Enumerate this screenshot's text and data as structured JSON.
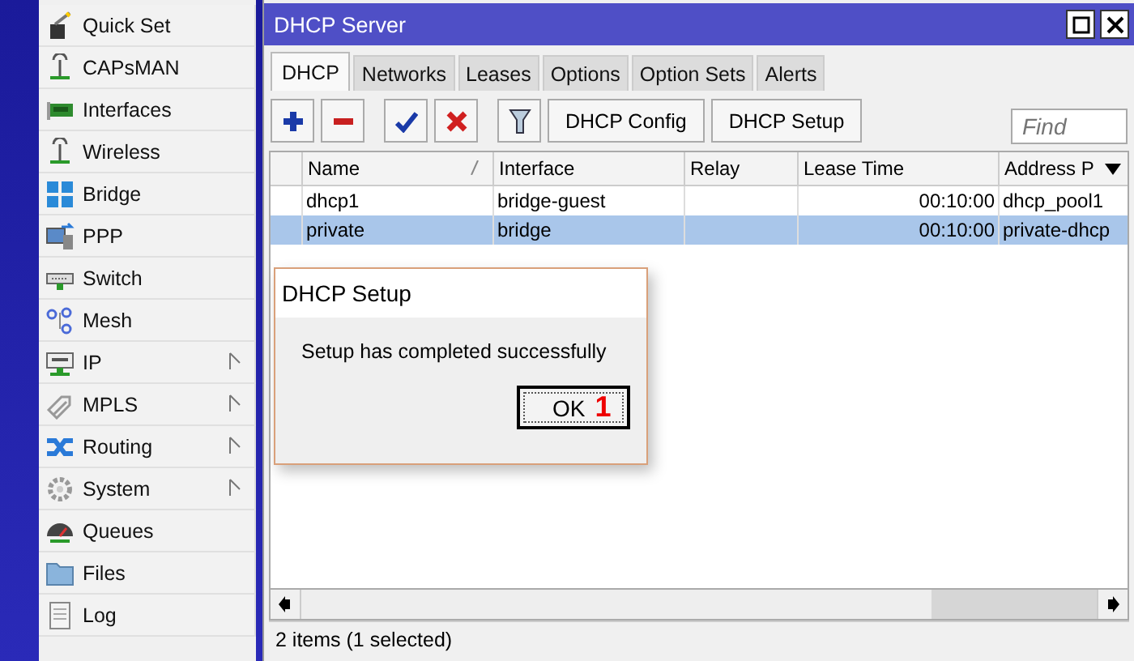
{
  "sidebar": {
    "items": [
      {
        "label": "Quick Set",
        "submenu": false
      },
      {
        "label": "CAPsMAN",
        "submenu": false
      },
      {
        "label": "Interfaces",
        "submenu": false
      },
      {
        "label": "Wireless",
        "submenu": false
      },
      {
        "label": "Bridge",
        "submenu": false
      },
      {
        "label": "PPP",
        "submenu": false
      },
      {
        "label": "Switch",
        "submenu": false
      },
      {
        "label": "Mesh",
        "submenu": false
      },
      {
        "label": "IP",
        "submenu": true
      },
      {
        "label": "MPLS",
        "submenu": true
      },
      {
        "label": "Routing",
        "submenu": true
      },
      {
        "label": "System",
        "submenu": true
      },
      {
        "label": "Queues",
        "submenu": false
      },
      {
        "label": "Files",
        "submenu": false
      },
      {
        "label": "Log",
        "submenu": false
      }
    ]
  },
  "window": {
    "title": "DHCP Server"
  },
  "tabs": [
    {
      "label": "DHCP",
      "selected": true
    },
    {
      "label": "Networks",
      "selected": false
    },
    {
      "label": "Leases",
      "selected": false
    },
    {
      "label": "Options",
      "selected": false
    },
    {
      "label": "Option Sets",
      "selected": false
    },
    {
      "label": "Alerts",
      "selected": false
    }
  ],
  "toolbar": {
    "buttons": [
      "DHCP Config",
      "DHCP Setup"
    ],
    "search": {
      "placeholder": "Find"
    }
  },
  "table": {
    "columns": [
      {
        "label": "Name",
        "sorted": true
      },
      {
        "label": "Interface",
        "sorted": false
      },
      {
        "label": "Relay",
        "sorted": false
      },
      {
        "label": "Lease Time",
        "sorted": false
      },
      {
        "label": "Address P",
        "sorted": false
      }
    ],
    "rows": [
      {
        "cells": [
          "dhcp1",
          "bridge-guest",
          "",
          "00:10:00",
          "dhcp_pool1"
        ],
        "selected": false
      },
      {
        "cells": [
          "private",
          "bridge",
          "",
          "00:10:00",
          "private-dhcp"
        ],
        "selected": true
      }
    ]
  },
  "status_bar": "2 items (1 selected)",
  "dialog": {
    "title": "DHCP Setup",
    "message": "Setup has completed successfully",
    "button": "OK",
    "annotation": "1"
  }
}
